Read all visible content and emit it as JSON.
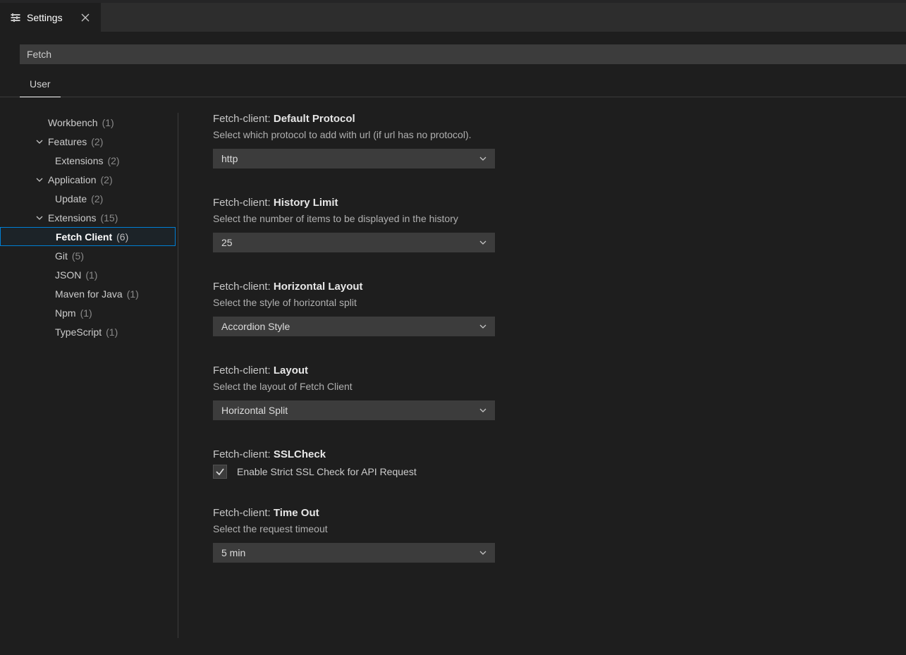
{
  "tab": {
    "title": "Settings"
  },
  "search": {
    "value": "Fetch"
  },
  "scope": {
    "user": "User"
  },
  "tree": {
    "workbench": {
      "label": "Workbench",
      "count": "(1)"
    },
    "features": {
      "label": "Features",
      "count": "(2)"
    },
    "features_extensions": {
      "label": "Extensions",
      "count": "(2)"
    },
    "application": {
      "label": "Application",
      "count": "(2)"
    },
    "application_update": {
      "label": "Update",
      "count": "(2)"
    },
    "extensions": {
      "label": "Extensions",
      "count": "(15)"
    },
    "fetch_client": {
      "label": "Fetch Client",
      "count": "(6)"
    },
    "git": {
      "label": "Git",
      "count": "(5)"
    },
    "json": {
      "label": "JSON",
      "count": "(1)"
    },
    "maven": {
      "label": "Maven for Java",
      "count": "(1)"
    },
    "npm": {
      "label": "Npm",
      "count": "(1)"
    },
    "typescript": {
      "label": "TypeScript",
      "count": "(1)"
    }
  },
  "settings": {
    "default_protocol": {
      "prefix": "Fetch-client:",
      "name": "Default Protocol",
      "desc": "Select which protocol to add with url (if url has no protocol).",
      "value": "http"
    },
    "history_limit": {
      "prefix": "Fetch-client:",
      "name": "History Limit",
      "desc": "Select the number of items to be displayed in the history",
      "value": "25"
    },
    "horizontal_layout": {
      "prefix": "Fetch-client:",
      "name": "Horizontal Layout",
      "desc": "Select the style of horizontal split",
      "value": "Accordion Style"
    },
    "layout": {
      "prefix": "Fetch-client:",
      "name": "Layout",
      "desc": "Select the layout of Fetch Client",
      "value": "Horizontal Split"
    },
    "ssl_check": {
      "prefix": "Fetch-client:",
      "name": "SSLCheck",
      "checkbox_label": "Enable Strict SSL Check for API Request"
    },
    "time_out": {
      "prefix": "Fetch-client:",
      "name": "Time Out",
      "desc": "Select the request timeout",
      "value": "5 min"
    }
  }
}
